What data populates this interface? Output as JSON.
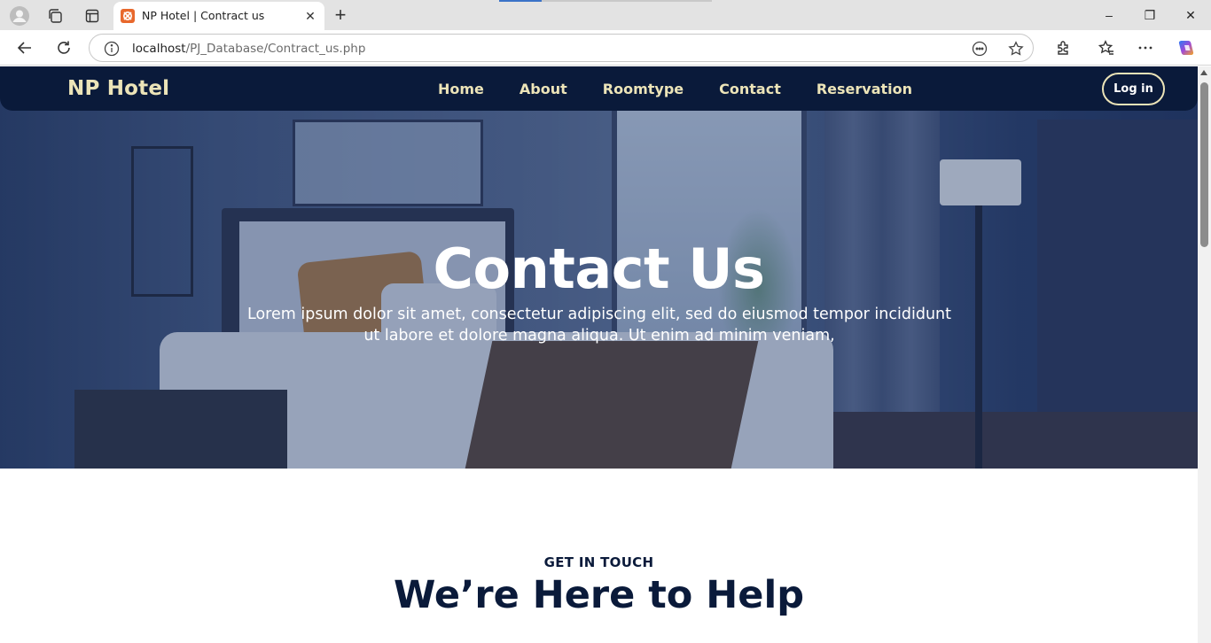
{
  "browser": {
    "tab": {
      "title": "NP Hotel | Contract us",
      "favicon": "xampp-icon",
      "close_glyph": "✕"
    },
    "new_tab_glyph": "+",
    "address": {
      "host": "localhost",
      "path": "/PJ_Database/Contract_us.php"
    },
    "window_controls": {
      "minimize": "–",
      "restore": "❐",
      "close": "✕"
    }
  },
  "site": {
    "brand": "NP Hotel",
    "nav": [
      {
        "label": "Home"
      },
      {
        "label": "About"
      },
      {
        "label": "Roomtype"
      },
      {
        "label": "Contact"
      },
      {
        "label": "Reservation"
      }
    ],
    "login_label": "Log in",
    "colors": {
      "navbar": "#0a1a3a",
      "accent": "#ece4b8"
    }
  },
  "hero": {
    "title": "Contact Us",
    "subtitle": "Lorem ipsum dolor sit amet, consectetur adipiscing elit, sed do eiusmod tempor incididunt ut labore et dolore magna aliqua. Ut enim ad minim veniam,"
  },
  "contact_section": {
    "kicker": "GET IN TOUCH",
    "title": "We’re Here to Help"
  }
}
